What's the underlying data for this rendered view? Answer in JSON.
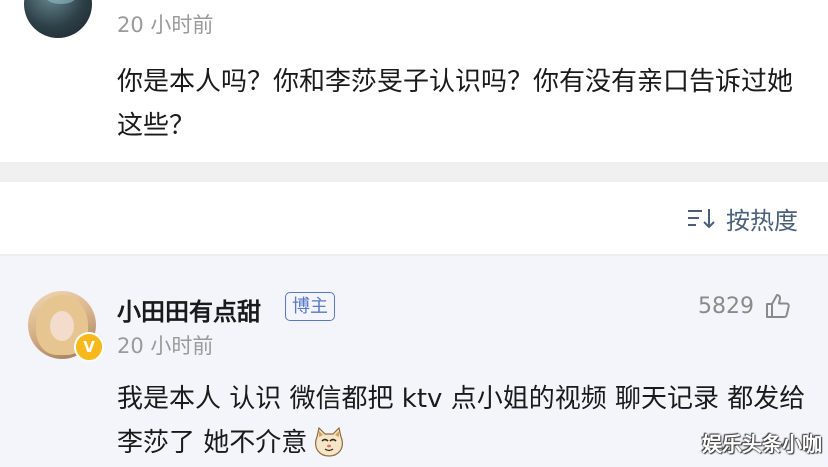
{
  "top_comment": {
    "time": "20 小时前",
    "text": "你是本人吗？你和李莎旻子认识吗？你有没有亲口告诉过她这些？"
  },
  "sort": {
    "icon": "sort-icon",
    "label": "按热度"
  },
  "reply": {
    "username": "小田田有点甜",
    "host_tag": "博主",
    "verified_icon": "V",
    "likes": "5829",
    "like_icon": "thumbs-up-icon",
    "time": "20 小时前",
    "text": "我是本人 认识 微信都把 ktv 点小姐的视频 聊天记录 都发给李莎了 她不介意",
    "emoji": "cat-emoji"
  },
  "watermark": "娱乐头条小咖",
  "colors": {
    "link_blue": "#4a5f7a",
    "host_tag": "#5a78c8",
    "verified": "#f6b81a",
    "muted": "#9a9a9a"
  }
}
